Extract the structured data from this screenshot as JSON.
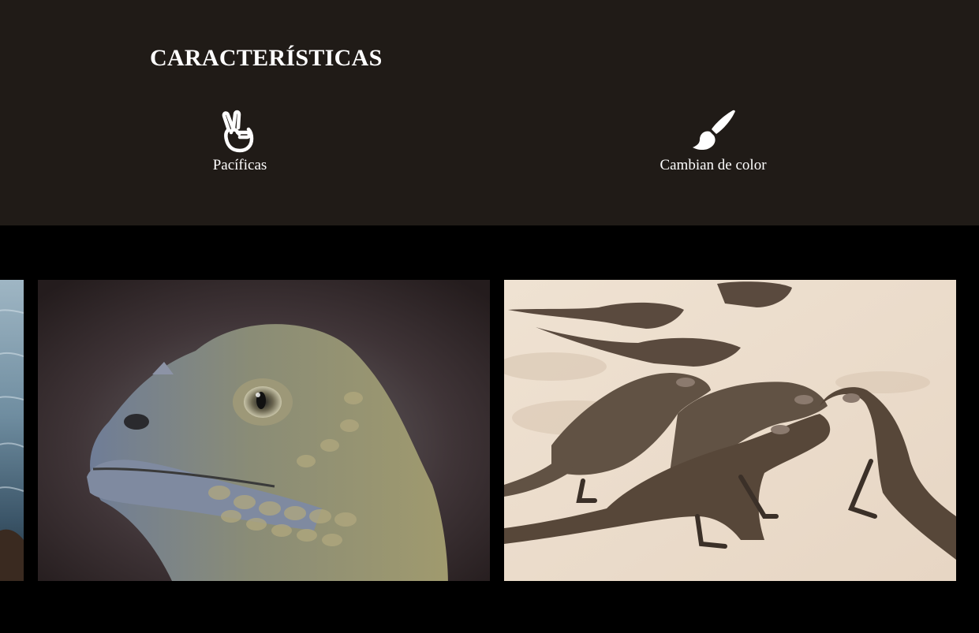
{
  "features": {
    "title": "CARACTERÍSTICAS",
    "items": [
      {
        "label": "Pacíficas",
        "icon": "peace-hand-icon"
      },
      {
        "label": "Cambian de color",
        "icon": "paintbrush-icon"
      }
    ]
  },
  "gallery": {
    "slides": [
      {
        "name": "ocean-partial-image"
      },
      {
        "name": "iguana-closeup-image"
      },
      {
        "name": "iguanas-on-beach-image"
      }
    ]
  },
  "colors": {
    "features_background": "#201b17",
    "gallery_background": "#000000",
    "text": "#ffffff"
  }
}
